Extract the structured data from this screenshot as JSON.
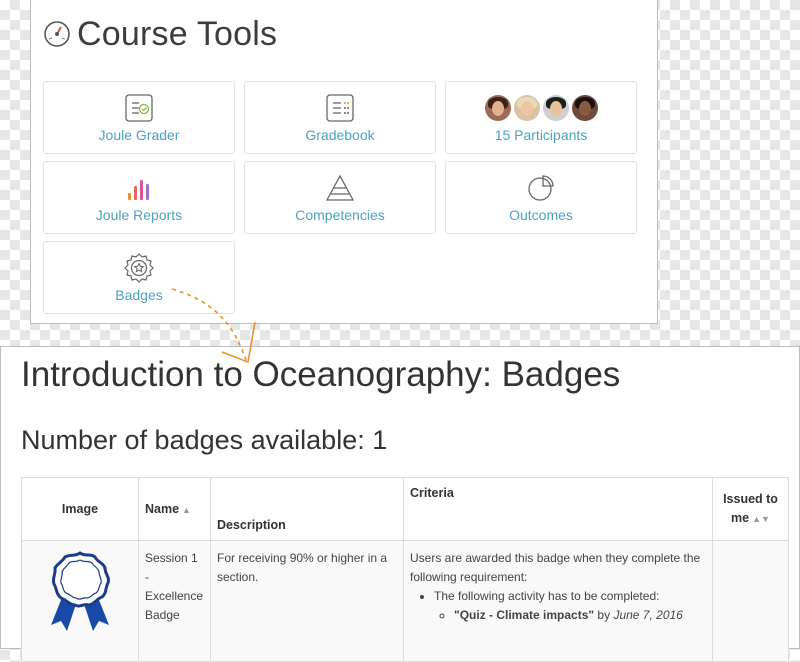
{
  "tools": {
    "title": "Course Tools",
    "tiles": {
      "joule_grader": "Joule Grader",
      "gradebook": "Gradebook",
      "participants": "15 Participants",
      "joule_reports": "Joule Reports",
      "competencies": "Competencies",
      "outcomes": "Outcomes",
      "badges": "Badges"
    },
    "accent_color": "#4aa3c2"
  },
  "badges_page": {
    "title": "Introduction to Oceanography: Badges",
    "count_text": "Number of badges available: 1",
    "table": {
      "headers": {
        "image": "Image",
        "name": "Name",
        "description": "Description",
        "criteria": "Criteria",
        "issued_line1": "Issued to",
        "issued_line2": "me"
      },
      "rows": [
        {
          "name_line1": "Session 1 -",
          "name_line2": "Excellence",
          "name_line3": "Badge",
          "description": "For receiving 90% or higher in a section.",
          "criteria_intro": "Users are awarded this badge when they complete the following requirement:",
          "criteria_item": "The following activity has to be completed:",
          "criteria_activity": "\"Quiz - Climate impacts\"",
          "criteria_by": "by",
          "criteria_date": "June 7, 2016"
        }
      ]
    }
  },
  "colors": {
    "arrow": "#e8922e",
    "ribbon": "#1a4aa8"
  }
}
